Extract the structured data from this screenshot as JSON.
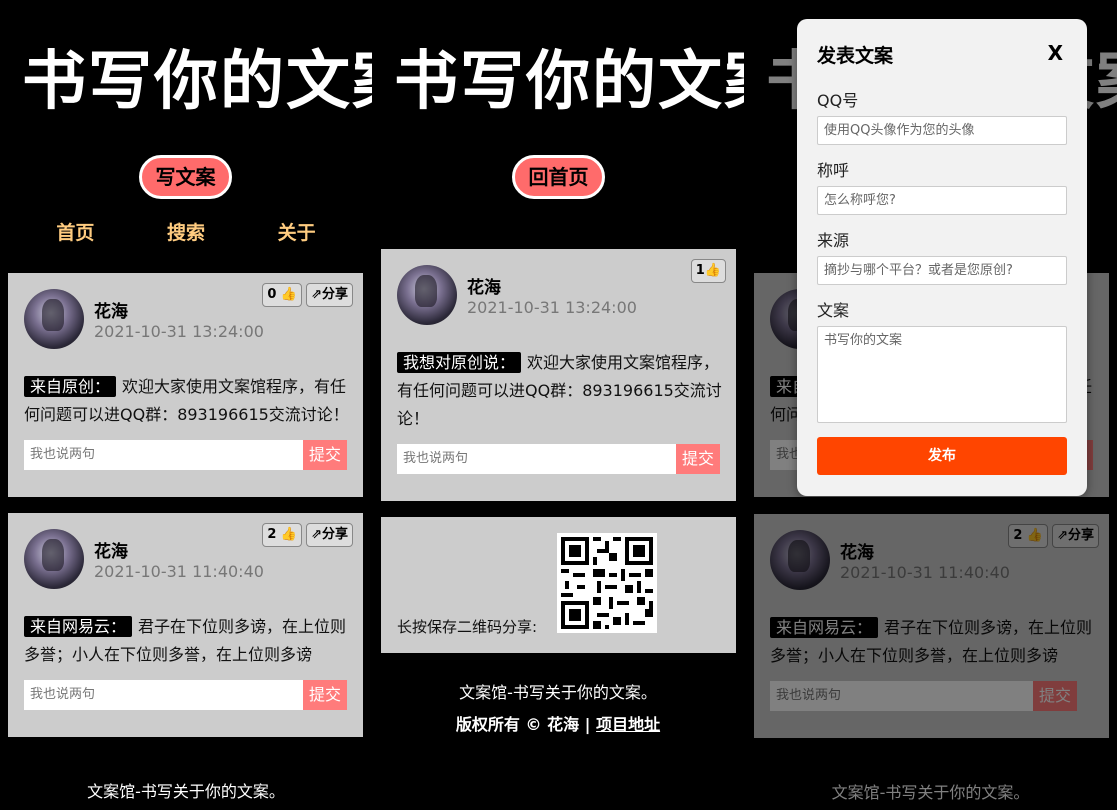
{
  "logo": "书写你的文案",
  "write_button": "写文案",
  "home_button": "回首页",
  "nav": [
    "首页",
    "搜索",
    "关于"
  ],
  "posts": [
    {
      "name": "花海",
      "time": "2021-10-31 13:24:00",
      "likes": "0",
      "share": "分享",
      "tag": "来自原创：",
      "text": "欢迎大家使用文案馆程序，有任何问题可以进QQ群：893196615交流讨论！"
    },
    {
      "name": "花海",
      "time": "2021-10-31 11:40:40",
      "likes": "2",
      "share": "分享",
      "tag": "来自网易云：",
      "text": "君子在下位则多谤，在上位则多誉；小人在下位则多誉，在上位则多谤"
    }
  ],
  "detail": {
    "name": "花海",
    "time": "2021-10-31 13:24:00",
    "likes": "1",
    "tag": "我想对原创说：",
    "text": "欢迎大家使用文案馆程序，有任何问题可以进QQ群：893196615交流讨论！"
  },
  "comment_placeholder": "我也说两句",
  "submit_label": "提交",
  "qr_label": "长按保存二维码分享:",
  "footer": {
    "line1": "文案馆-书写关于你的文案。",
    "copyright": "版权所有 © 花海 | ",
    "project_link": "项目地址"
  },
  "modal": {
    "title": "发表文案",
    "close": "X",
    "qq_label": "QQ号",
    "qq_placeholder": "使用QQ头像作为您的头像",
    "name_label": "称呼",
    "name_placeholder": "怎么称呼您?",
    "source_label": "来源",
    "source_placeholder": "摘抄与哪个平台？或者是您原创?",
    "text_label": "文案",
    "text_placeholder": "书写你的文案",
    "publish": "发布"
  },
  "colors": {
    "accent": "#ff6b6b",
    "nav": "#ffcc80",
    "publish": "#ff4500",
    "card": "#cccccc"
  }
}
